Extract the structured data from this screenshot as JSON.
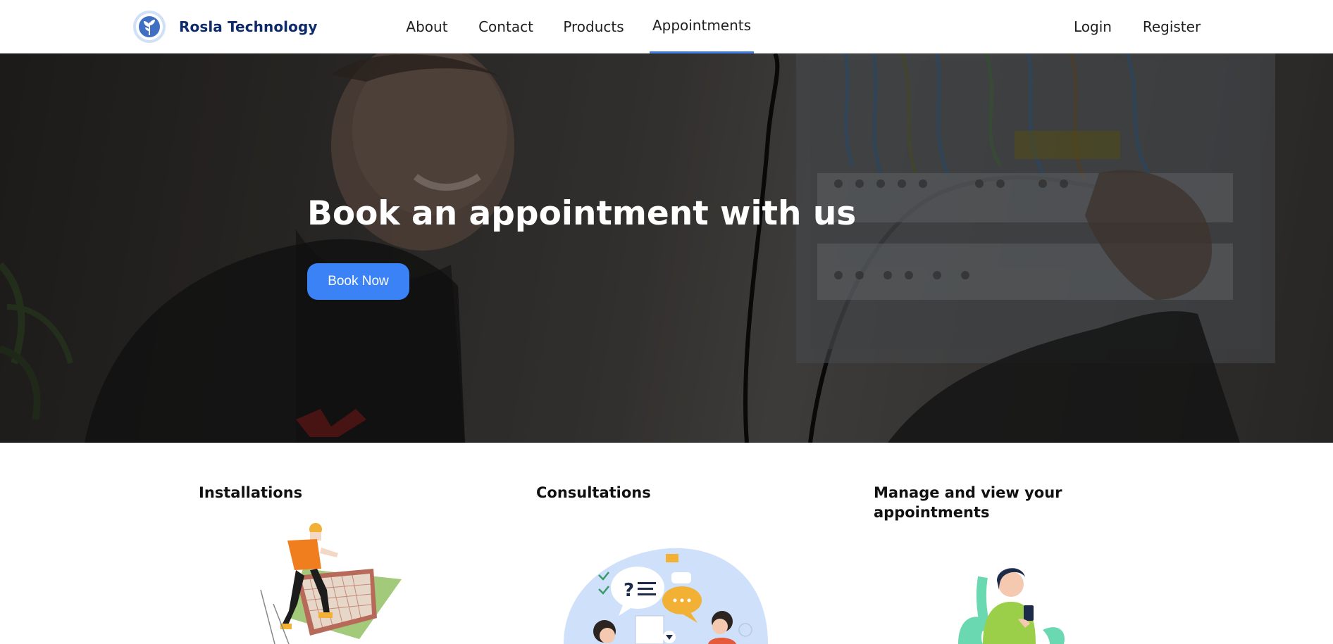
{
  "brand": {
    "name": "Rosla Technology",
    "logo_icon": "sprout-logo-icon"
  },
  "nav": {
    "links": [
      {
        "label": "About",
        "active": false
      },
      {
        "label": "Contact",
        "active": false
      },
      {
        "label": "Products",
        "active": false
      },
      {
        "label": "Appointments",
        "active": true
      }
    ],
    "auth": {
      "login": "Login",
      "register": "Register"
    }
  },
  "hero": {
    "title": "Book an appointment with us",
    "cta_label": "Book Now"
  },
  "services": [
    {
      "title": "Installations",
      "icon": "solar-panel-installer-illustration"
    },
    {
      "title": "Consultations",
      "icon": "consultation-chat-illustration"
    },
    {
      "title": "Manage and view your appointments",
      "icon": "person-with-phone-illustration"
    }
  ],
  "colors": {
    "accent": "#3b82f6",
    "nav_active_underline": "#3f7be0",
    "brand_text": "#0d2a6b",
    "hero_overlay": "#2f2d2b"
  }
}
